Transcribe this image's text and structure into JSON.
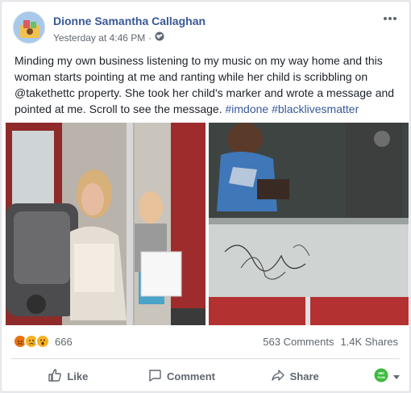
{
  "post": {
    "author": "Dionne Samantha Callaghan",
    "timestamp": "Yesterday at 4:46 PM",
    "privacy_icon": "globe-icon",
    "text_main": "Minding my own business listening to my music on my way home and this woman starts pointing at me and ranting while her child is scribbling on @takethettc property. She took her child's marker and wrote a message and pointed at me. Scroll to see the message.",
    "hashtag_1": "#imdone",
    "hashtag_2": "#blacklivesmatter"
  },
  "reactions": {
    "icons": [
      "angry-icon",
      "sad-icon",
      "wow-icon"
    ],
    "count": "666"
  },
  "stats": {
    "comments": "563 Comments",
    "shares": "1.4K Shares"
  },
  "actions": {
    "like": "Like",
    "comment": "Comment",
    "share": "Share",
    "audience_badge": "580 TEAM"
  },
  "colors": {
    "link_blue": "#385898",
    "text": "#1d2129",
    "meta_gray": "#616770",
    "angry": "#e9710f",
    "wow": "#f7b125",
    "badge_green": "#3fba3f"
  }
}
